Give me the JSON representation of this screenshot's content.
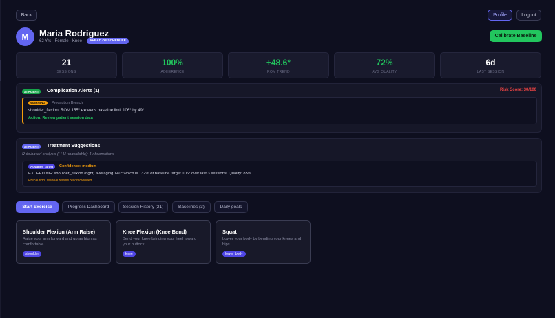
{
  "nav": {
    "back": "Back",
    "profile": "Profile",
    "logout": "Logout"
  },
  "patient": {
    "initial": "M",
    "name": "Maria Rodriguez",
    "meta": "62 Yrs · Female · Knee",
    "status_badge": "AHEAD OF SCHEDULE"
  },
  "actions": {
    "calibrate": "Calibrate Baseline"
  },
  "stats": [
    {
      "value": "21",
      "label": "SESSIONS",
      "color": "#ffffff"
    },
    {
      "value": "100%",
      "label": "ADHERENCE",
      "color": "#22c55e"
    },
    {
      "value": "+48.6°",
      "label": "ROM TREND",
      "color": "#22c55e"
    },
    {
      "value": "72%",
      "label": "AVG QUALITY",
      "color": "#22c55e"
    },
    {
      "value": "6d",
      "label": "LAST SESSION",
      "color": "#ffffff"
    }
  ],
  "complications": {
    "badge": "AI AGENT",
    "title": "Complication Alerts (1)",
    "risk": "Risk Score: 30/100",
    "alert": {
      "level": "WARNING",
      "type": "Precaution Breach",
      "text": "shoulder_flexion: ROM 155° exceeds baseline limit 106° by 49°",
      "action": "Action: Review patient session data"
    }
  },
  "suggestions": {
    "badge": "AI AGENT",
    "title": "Treatment Suggestions",
    "meta": "Rule-based analysis (LLM unavailable): 1 observations",
    "item": {
      "tag": "Advance Target",
      "confidence": "Confidence: medium",
      "text": "EXCEEDING: shoulder_flexion (right) averaging 140° which is 132% of baseline target 106° over last 3 sessions. Quality: 85%",
      "precaution": "Precaution: Manual review recommended"
    }
  },
  "tabs": [
    {
      "label": "Start Exercise",
      "active": true
    },
    {
      "label": "Progress Dashboard",
      "active": false
    },
    {
      "label": "Session History (21)",
      "active": false
    },
    {
      "label": "Baselines (3)",
      "active": false
    },
    {
      "label": "Daily goals",
      "active": false
    }
  ],
  "exercises": [
    {
      "title": "Shoulder Flexion (Arm Raise)",
      "desc": "Raise your arm forward and up as high as comfortable",
      "tag": "shoulder"
    },
    {
      "title": "Knee Flexion (Knee Bend)",
      "desc": "Bend your knee bringing your heel toward your buttock",
      "tag": "knee"
    },
    {
      "title": "Squat",
      "desc": "Lower your body by bending your knees and hips",
      "tag": "lower_body"
    }
  ],
  "colors": {
    "accent": "#6366f1",
    "success": "#22c55e",
    "warning": "#f59e0b",
    "danger": "#ef4444"
  }
}
